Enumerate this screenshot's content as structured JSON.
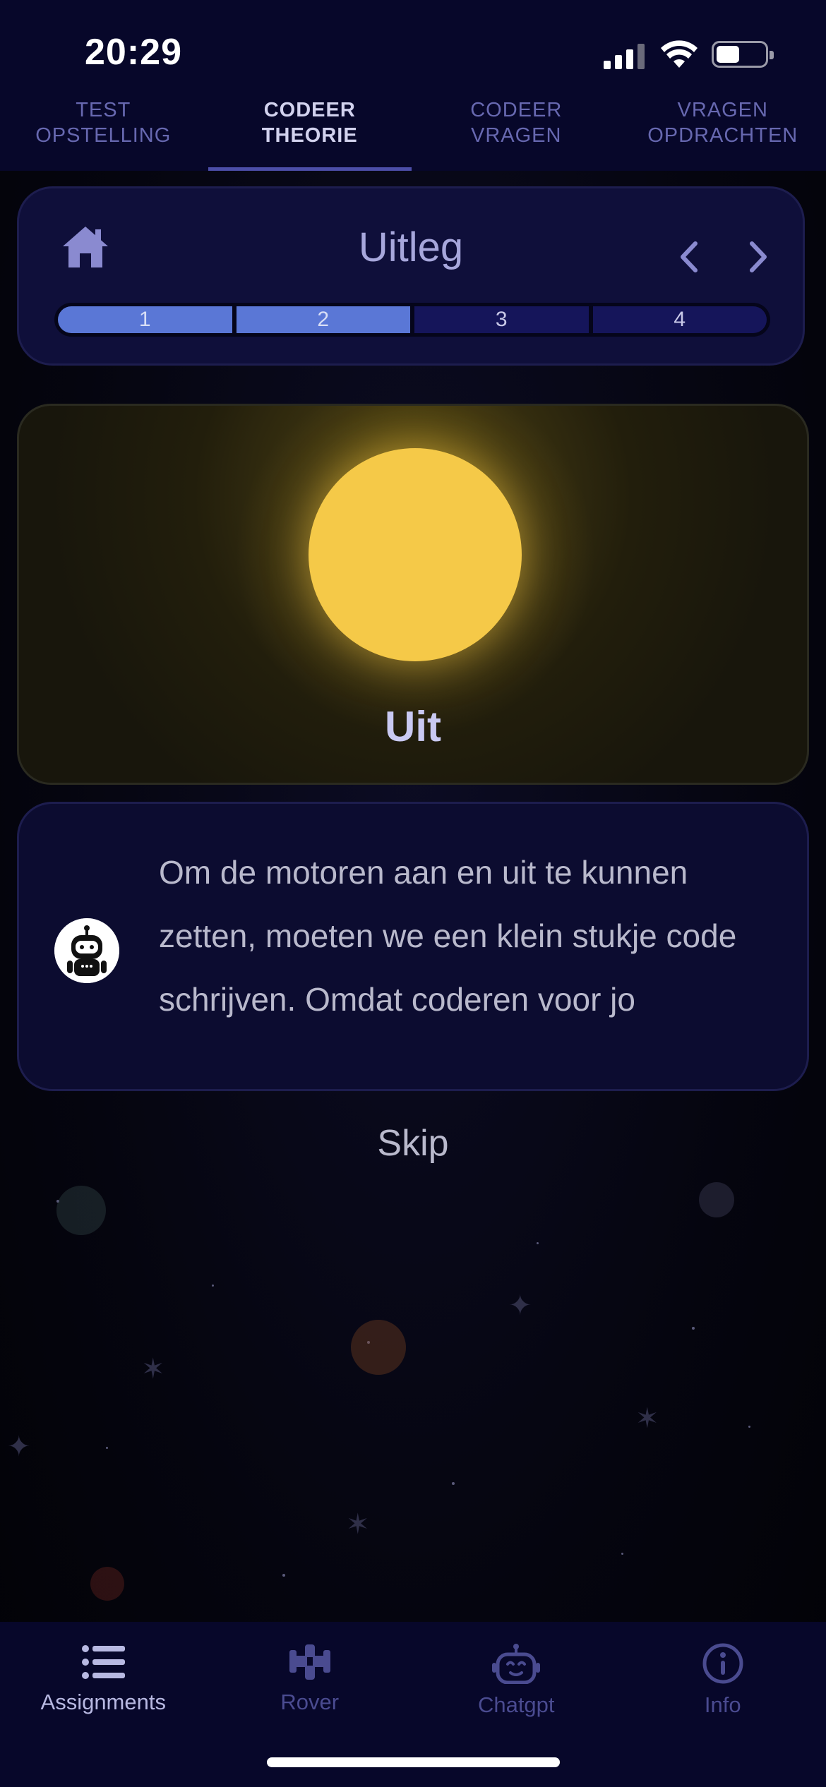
{
  "status_bar": {
    "time": "20:29",
    "icons": [
      "signal-icon",
      "wifi-icon",
      "battery-icon"
    ]
  },
  "top_tabs": [
    {
      "line1": "TEST",
      "line2": "OPSTELLING",
      "active": false
    },
    {
      "line1": "CODEER",
      "line2": "THEORIE",
      "active": true
    },
    {
      "line1": "CODEER",
      "line2": "VRAGEN",
      "active": false
    },
    {
      "line1": "VRAGEN",
      "line2": "OPDRACHTEN",
      "active": false
    }
  ],
  "header": {
    "title": "Uitleg",
    "home_icon": "home-icon",
    "prev_icon": "chevron-left-icon",
    "next_icon": "chevron-right-icon",
    "steps": [
      "1",
      "2",
      "3",
      "4"
    ],
    "completed_steps": 2
  },
  "sun_card": {
    "label": "Uit",
    "sun_color": "#f5c948"
  },
  "message": {
    "avatar_icon": "robot-icon",
    "text": "Om de motoren aan en uit te kunnen zetten, moeten we een klein stukje code schrijven. Omdat coderen voor jo"
  },
  "skip_label": "Skip",
  "bottom_nav": [
    {
      "label": "Assignments",
      "icon": "list-icon",
      "active": true
    },
    {
      "label": "Rover",
      "icon": "rover-icon",
      "active": false
    },
    {
      "label": "Chatgpt",
      "icon": "robot-icon",
      "active": false
    },
    {
      "label": "Info",
      "icon": "info-icon",
      "active": false
    }
  ],
  "colors": {
    "accent": "#5a77d6",
    "background": "#06061a",
    "tab_active": "#d2d2ee",
    "tab_inactive": "#6768b0"
  }
}
